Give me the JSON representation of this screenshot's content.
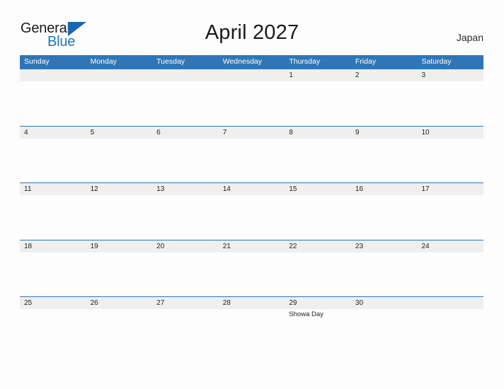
{
  "brand": {
    "name_part1": "General",
    "name_part2": "Blue",
    "accent_color": "#1577c4",
    "flag_color": "#1668b3"
  },
  "header": {
    "title": "April 2027",
    "country": "Japan"
  },
  "calendar": {
    "header_bg": "#2f76b8",
    "date_strip_bg": "#efefef",
    "weekdays": [
      "Sunday",
      "Monday",
      "Tuesday",
      "Wednesday",
      "Thursday",
      "Friday",
      "Saturday"
    ],
    "weeks": [
      {
        "days": [
          {
            "num": "",
            "event": ""
          },
          {
            "num": "",
            "event": ""
          },
          {
            "num": "",
            "event": ""
          },
          {
            "num": "",
            "event": ""
          },
          {
            "num": "1",
            "event": ""
          },
          {
            "num": "2",
            "event": ""
          },
          {
            "num": "3",
            "event": ""
          }
        ]
      },
      {
        "days": [
          {
            "num": "4",
            "event": ""
          },
          {
            "num": "5",
            "event": ""
          },
          {
            "num": "6",
            "event": ""
          },
          {
            "num": "7",
            "event": ""
          },
          {
            "num": "8",
            "event": ""
          },
          {
            "num": "9",
            "event": ""
          },
          {
            "num": "10",
            "event": ""
          }
        ]
      },
      {
        "days": [
          {
            "num": "11",
            "event": ""
          },
          {
            "num": "12",
            "event": ""
          },
          {
            "num": "13",
            "event": ""
          },
          {
            "num": "14",
            "event": ""
          },
          {
            "num": "15",
            "event": ""
          },
          {
            "num": "16",
            "event": ""
          },
          {
            "num": "17",
            "event": ""
          }
        ]
      },
      {
        "days": [
          {
            "num": "18",
            "event": ""
          },
          {
            "num": "19",
            "event": ""
          },
          {
            "num": "20",
            "event": ""
          },
          {
            "num": "21",
            "event": ""
          },
          {
            "num": "22",
            "event": ""
          },
          {
            "num": "23",
            "event": ""
          },
          {
            "num": "24",
            "event": ""
          }
        ]
      },
      {
        "days": [
          {
            "num": "25",
            "event": ""
          },
          {
            "num": "26",
            "event": ""
          },
          {
            "num": "27",
            "event": ""
          },
          {
            "num": "28",
            "event": ""
          },
          {
            "num": "29",
            "event": "Showa Day"
          },
          {
            "num": "30",
            "event": ""
          },
          {
            "num": "",
            "event": ""
          }
        ]
      }
    ]
  }
}
